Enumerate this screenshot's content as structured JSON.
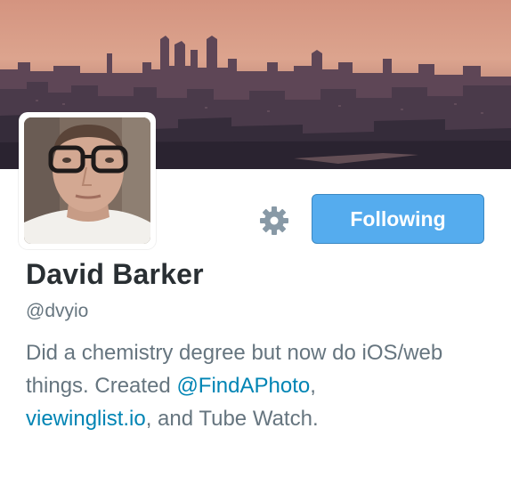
{
  "profile": {
    "name": "David Barker",
    "handle": "@dvyio",
    "bio": {
      "part1": "Did a chemistry degree but now do iOS/web things. Created ",
      "mention": "@FindAPhoto",
      "part2": ", ",
      "link": "viewinglist.io",
      "part3": ", and Tube Watch."
    }
  },
  "actions": {
    "follow_label": "Following",
    "settings_icon": "gear-icon"
  },
  "colors": {
    "accent": "#55acee",
    "link": "#0084b4",
    "name_text": "#292f33",
    "secondary_text": "#66757f"
  }
}
